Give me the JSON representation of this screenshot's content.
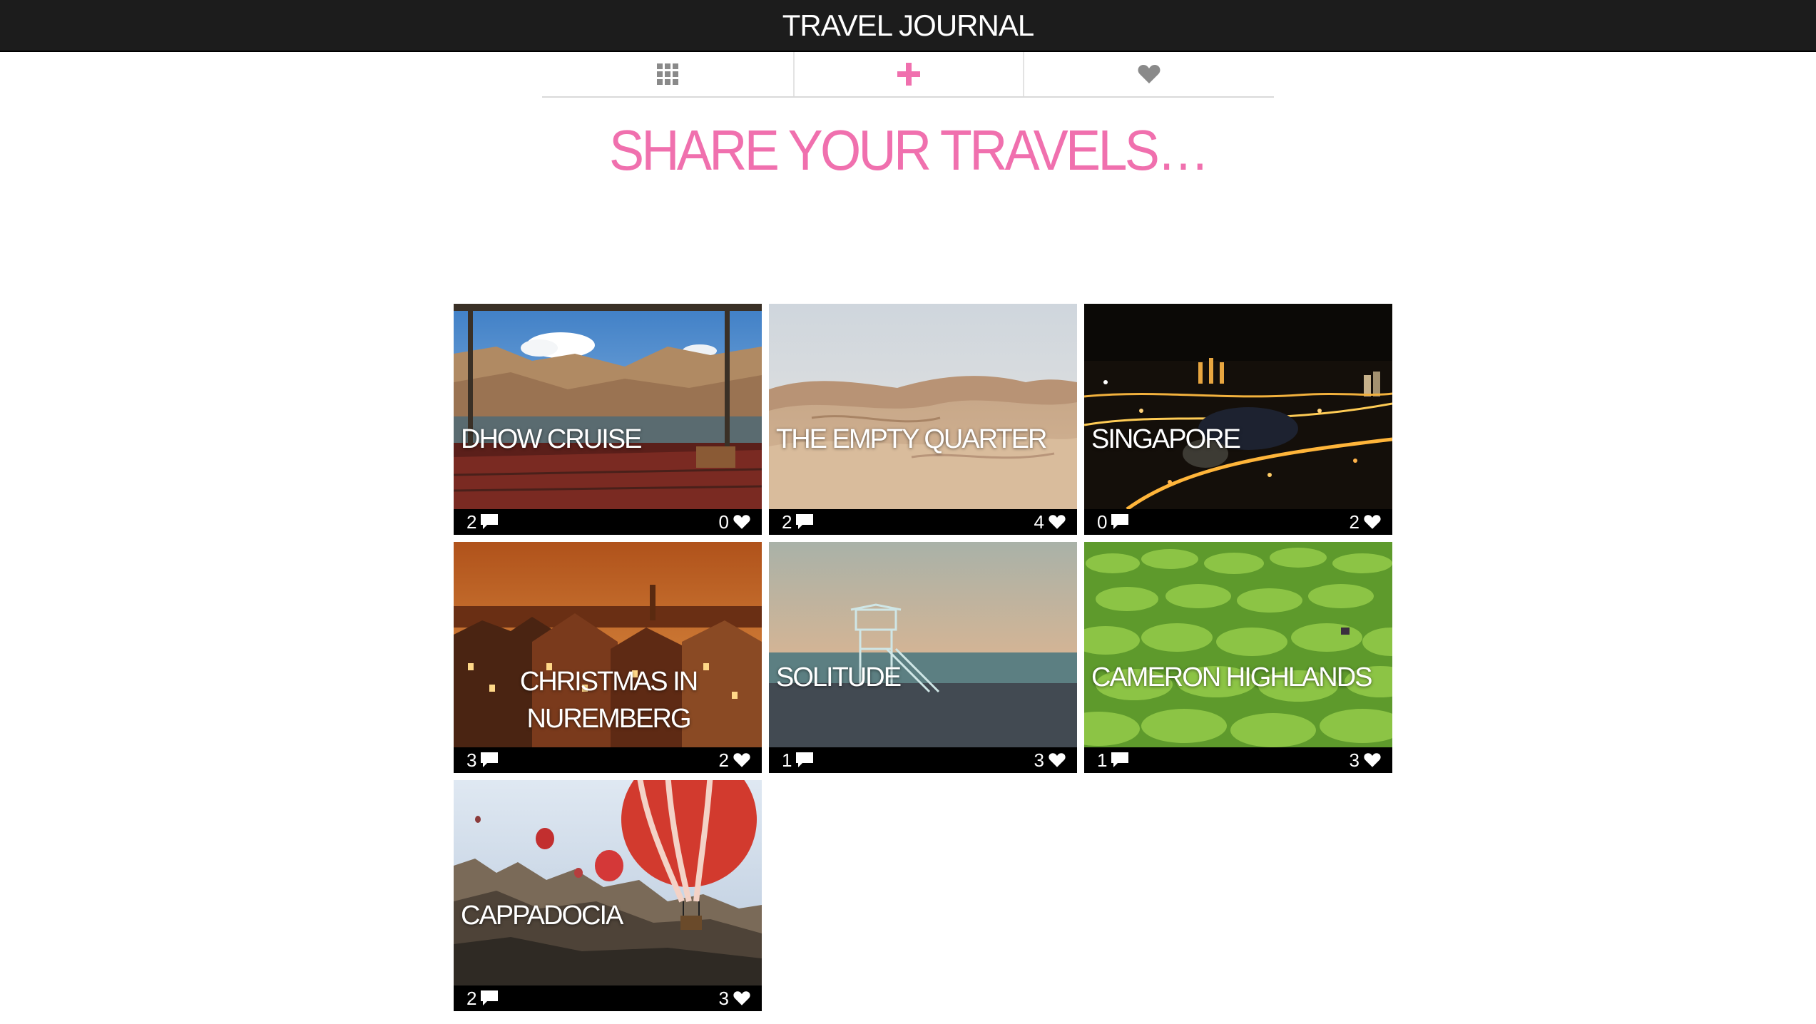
{
  "header": {
    "title": "TRAVEL JOURNAL"
  },
  "nav": {
    "tabs": [
      {
        "icon": "grid-icon",
        "color": "#8a8a8a"
      },
      {
        "icon": "plus-icon",
        "color": "#f070ae"
      },
      {
        "icon": "heart-icon",
        "color": "#8a8a8a"
      }
    ]
  },
  "page": {
    "heading": "SHARE YOUR TRAVELS…"
  },
  "colors": {
    "accent": "#f070ae",
    "header_bg": "#1c1c1c"
  },
  "entries": [
    {
      "title": "DHOW CRUISE",
      "comments": "2",
      "likes": "0",
      "comment_icon": "comment-icon",
      "like_icon": "heart-icon"
    },
    {
      "title": "THE EMPTY QUARTER",
      "comments": "2",
      "likes": "4",
      "comment_icon": "comment-icon",
      "like_icon": "heart-icon"
    },
    {
      "title": "SINGAPORE",
      "comments": "0",
      "likes": "2",
      "comment_icon": "comment-icon",
      "like_icon": "heart-icon"
    },
    {
      "title": "CHRISTMAS IN NUREMBERG",
      "comments": "3",
      "likes": "2",
      "comment_icon": "comment-icon",
      "like_icon": "heart-icon"
    },
    {
      "title": "SOLITUDE",
      "comments": "1",
      "likes": "3",
      "comment_icon": "comment-icon",
      "like_icon": "heart-icon"
    },
    {
      "title": "CAMERON HIGHLANDS",
      "comments": "1",
      "likes": "3",
      "comment_icon": "comment-icon",
      "like_icon": "heart-icon"
    },
    {
      "title": "CAPPADOCIA",
      "comments": "2",
      "likes": "3",
      "comment_icon": "comment-icon",
      "like_icon": "heart-icon"
    }
  ]
}
